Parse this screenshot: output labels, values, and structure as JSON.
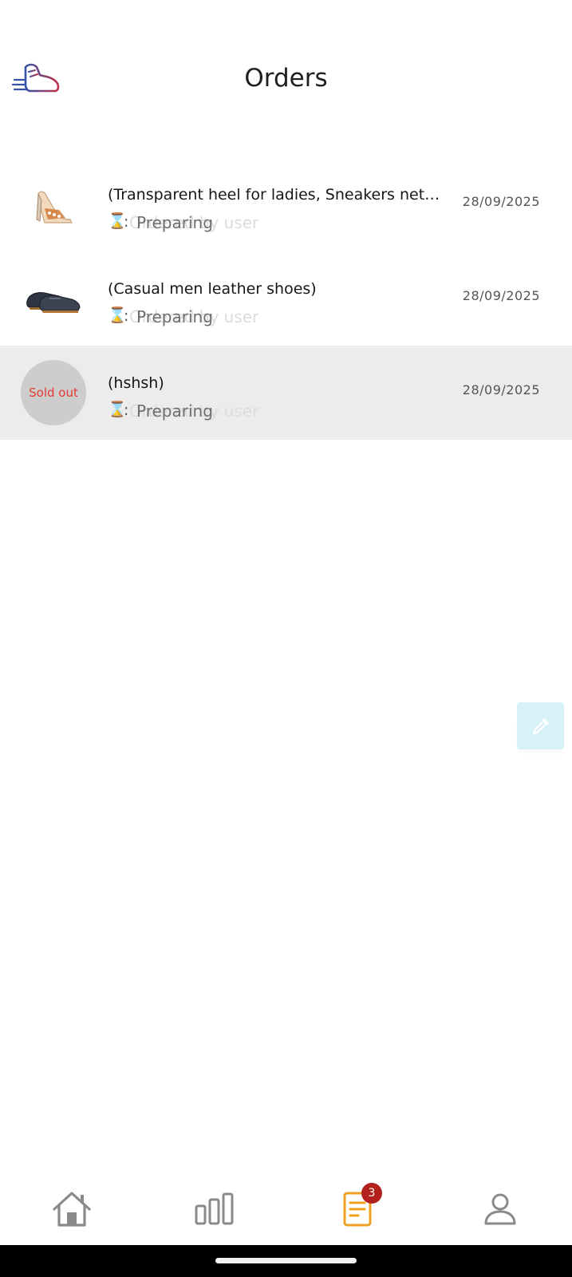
{
  "header": {
    "title": "Orders",
    "logo_icon": "running-shoe-logo"
  },
  "orders": [
    {
      "name": "(Transparent heel for ladies, Sneakers net/white, Casual men leather shoes)",
      "status_icon": "hourglass-icon",
      "status": "Preparing",
      "ghost_status": "Ordered by user",
      "date": "28/09/2025",
      "thumbnail": "transparent-heel-shoe-image"
    },
    {
      "name": "(Casual men leather shoes)",
      "status_icon": "hourglass-icon",
      "status": "Preparing",
      "ghost_status": "Ordered by user",
      "date": "28/09/2025",
      "thumbnail": "leather-shoes-image"
    },
    {
      "name": "(hshsh)",
      "status_icon": "hourglass-icon",
      "status": "Preparing",
      "ghost_status": "Ordered by user",
      "date": "28/09/2025",
      "thumbnail_label": "Sold out"
    }
  ],
  "fab": {
    "icon": "eyedropper-icon",
    "color": "#d6f1f8"
  },
  "bottom_nav": {
    "items": [
      {
        "name": "home",
        "icon": "home-icon"
      },
      {
        "name": "stats",
        "icon": "bar-chart-icon"
      },
      {
        "name": "orders",
        "icon": "orders-icon",
        "badge": "3",
        "active": true
      },
      {
        "name": "profile",
        "icon": "user-icon"
      }
    ],
    "active_color": "#f0a020",
    "inactive_color": "#8a8a8a",
    "badge_color": "#b3211c"
  }
}
